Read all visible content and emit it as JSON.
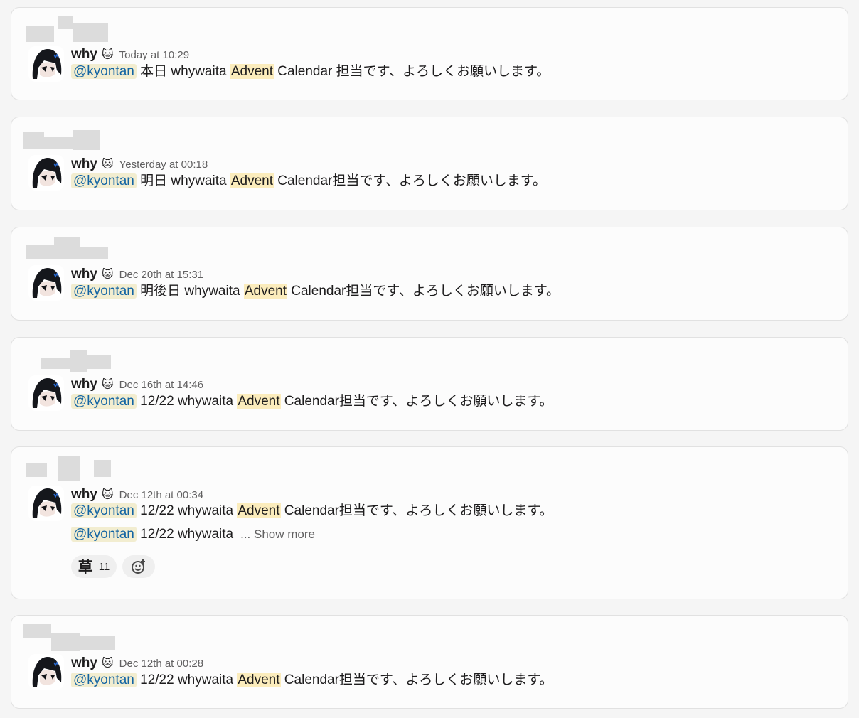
{
  "messages": [
    {
      "author": "why",
      "author_emoji": "🐱",
      "timestamp": "Today at 10:29",
      "mention": "@kyontan",
      "text_before": " 本日 whywaita ",
      "highlight": "Advent",
      "text_after": " Calendar 担当です、よろしくお願いします。"
    },
    {
      "author": "why",
      "author_emoji": "🐱",
      "timestamp": "Yesterday at 00:18",
      "mention": "@kyontan",
      "text_before": " 明日 whywaita ",
      "highlight": "Advent",
      "text_after": " Calendar担当です、よろしくお願いします。"
    },
    {
      "author": "why",
      "author_emoji": "🐱",
      "timestamp": "Dec 20th at 15:31",
      "mention": "@kyontan",
      "text_before": " 明後日 whywaita ",
      "highlight": "Advent",
      "text_after": " Calendar担当です、よろしくお願いします。"
    },
    {
      "author": "why",
      "author_emoji": "🐱",
      "timestamp": "Dec 16th at 14:46",
      "mention": "@kyontan",
      "text_before": " 12/22 whywaita ",
      "highlight": "Advent",
      "text_after": " Calendar担当です、よろしくお願いします。"
    },
    {
      "author": "why",
      "author_emoji": "🐱",
      "timestamp": "Dec 12th at 00:34",
      "mention": "@kyontan",
      "text_before": " 12/22 whywaita ",
      "highlight": "Advent",
      "text_after": " Calendar担当です、よろしくお願いします。",
      "second_mention": "@kyontan",
      "second_text": " 12/22 whywaita",
      "show_more": "... Show more",
      "reaction_emoji": "草",
      "reaction_count": "11"
    },
    {
      "author": "why",
      "author_emoji": "🐱",
      "timestamp": "Dec 12th at 00:28",
      "mention": "@kyontan",
      "text_before": " 12/22 whywaita ",
      "highlight": "Advent",
      "text_after": " Calendar担当です、よろしくお願いします。"
    }
  ]
}
